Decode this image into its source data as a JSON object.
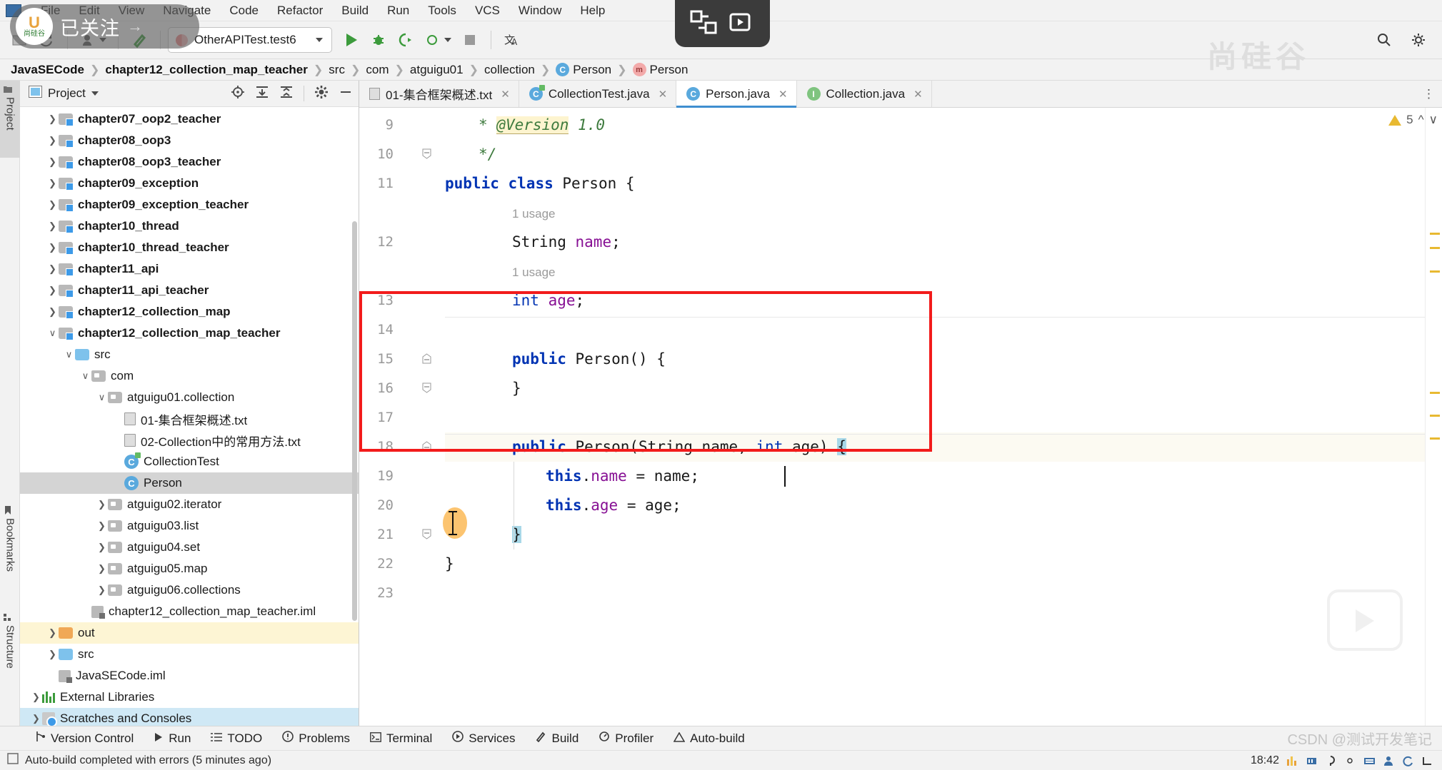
{
  "menubar": {
    "items": [
      "File",
      "Edit",
      "View",
      "Navigate",
      "Code",
      "Refactor",
      "Build",
      "Run",
      "Tools",
      "VCS",
      "Window",
      "Help"
    ],
    "window_icon": "windows-icon"
  },
  "toolbar": {
    "project_icon": "project-folder-icon",
    "sync_icon": "sync-icon",
    "user_icon": "user-icon",
    "hammer_icon": "build-hammer-icon",
    "run_config": "OtherAPITest.test6",
    "run_icon": "run-icon",
    "debug_icon": "debug-icon",
    "coverage_icon": "run-with-coverage-icon",
    "profile_icon": "profile-icon",
    "stop_icon": "stop-icon",
    "translate_icon": "translate-icon",
    "search_icon": "search-icon",
    "settings_icon": "settings-icon"
  },
  "breadcrumb": [
    {
      "label": "JavaSECode",
      "bold": true,
      "icon": null
    },
    {
      "label": "chapter12_collection_map_teacher",
      "bold": true,
      "icon": null
    },
    {
      "label": "src",
      "bold": false,
      "icon": null
    },
    {
      "label": "com",
      "bold": false,
      "icon": null
    },
    {
      "label": "atguigu01",
      "bold": false,
      "icon": null
    },
    {
      "label": "collection",
      "bold": false,
      "icon": null
    },
    {
      "label": "Person",
      "bold": false,
      "icon": "class-icon"
    },
    {
      "label": "Person",
      "bold": false,
      "icon": "method-icon"
    }
  ],
  "rail": {
    "project_label": "Project",
    "bookmarks_label": "Bookmarks",
    "structure_label": "Structure"
  },
  "project_panel": {
    "title": "Project",
    "dropdown_icon": "chevron-down-icon",
    "locate_icon": "locate-icon",
    "expand_icon": "expand-all-icon",
    "collapse_icon": "collapse-all-icon",
    "settings_icon": "gear-icon",
    "hide_icon": "minimize-icon",
    "tree": [
      {
        "label": "chapter07_oop2_teacher",
        "indent": 1,
        "arrow": "right",
        "icon": "module-folder",
        "bold": true,
        "state": ""
      },
      {
        "label": "chapter08_oop3",
        "indent": 1,
        "arrow": "right",
        "icon": "module-folder",
        "bold": true,
        "state": ""
      },
      {
        "label": "chapter08_oop3_teacher",
        "indent": 1,
        "arrow": "right",
        "icon": "module-folder",
        "bold": true,
        "state": ""
      },
      {
        "label": "chapter09_exception",
        "indent": 1,
        "arrow": "right",
        "icon": "module-folder",
        "bold": true,
        "state": ""
      },
      {
        "label": "chapter09_exception_teacher",
        "indent": 1,
        "arrow": "right",
        "icon": "module-folder",
        "bold": true,
        "state": ""
      },
      {
        "label": "chapter10_thread",
        "indent": 1,
        "arrow": "right",
        "icon": "module-folder",
        "bold": true,
        "state": ""
      },
      {
        "label": "chapter10_thread_teacher",
        "indent": 1,
        "arrow": "right",
        "icon": "module-folder",
        "bold": true,
        "state": ""
      },
      {
        "label": "chapter11_api",
        "indent": 1,
        "arrow": "right",
        "icon": "module-folder",
        "bold": true,
        "state": ""
      },
      {
        "label": "chapter11_api_teacher",
        "indent": 1,
        "arrow": "right",
        "icon": "module-folder",
        "bold": true,
        "state": ""
      },
      {
        "label": "chapter12_collection_map",
        "indent": 1,
        "arrow": "right",
        "icon": "module-folder",
        "bold": true,
        "state": ""
      },
      {
        "label": "chapter12_collection_map_teacher",
        "indent": 1,
        "arrow": "down",
        "icon": "module-folder",
        "bold": true,
        "state": ""
      },
      {
        "label": "src",
        "indent": 2,
        "arrow": "down",
        "icon": "source-folder",
        "bold": false,
        "state": ""
      },
      {
        "label": "com",
        "indent": 3,
        "arrow": "down",
        "icon": "package",
        "bold": false,
        "state": ""
      },
      {
        "label": "atguigu01.collection",
        "indent": 4,
        "arrow": "down",
        "icon": "package",
        "bold": false,
        "state": ""
      },
      {
        "label": "01-集合框架概述.txt",
        "indent": 5,
        "arrow": "none",
        "icon": "text-file",
        "bold": false,
        "state": ""
      },
      {
        "label": "02-Collection中的常用方法.txt",
        "indent": 5,
        "arrow": "none",
        "icon": "text-file",
        "bold": false,
        "state": ""
      },
      {
        "label": "CollectionTest",
        "indent": 5,
        "arrow": "none",
        "icon": "runnable-class",
        "bold": false,
        "state": ""
      },
      {
        "label": "Person",
        "indent": 5,
        "arrow": "none",
        "icon": "class",
        "bold": false,
        "state": "sel"
      },
      {
        "label": "atguigu02.iterator",
        "indent": 4,
        "arrow": "right",
        "icon": "package",
        "bold": false,
        "state": ""
      },
      {
        "label": "atguigu03.list",
        "indent": 4,
        "arrow": "right",
        "icon": "package",
        "bold": false,
        "state": ""
      },
      {
        "label": "atguigu04.set",
        "indent": 4,
        "arrow": "right",
        "icon": "package",
        "bold": false,
        "state": ""
      },
      {
        "label": "atguigu05.map",
        "indent": 4,
        "arrow": "right",
        "icon": "package",
        "bold": false,
        "state": ""
      },
      {
        "label": "atguigu06.collections",
        "indent": 4,
        "arrow": "right",
        "icon": "package",
        "bold": false,
        "state": ""
      },
      {
        "label": "chapter12_collection_map_teacher.iml",
        "indent": 3,
        "arrow": "none",
        "icon": "iml-file",
        "bold": false,
        "state": ""
      },
      {
        "label": "out",
        "indent": 1,
        "arrow": "right",
        "icon": "out-folder",
        "bold": false,
        "state": "hl"
      },
      {
        "label": "src",
        "indent": 1,
        "arrow": "right",
        "icon": "source-folder",
        "bold": false,
        "state": ""
      },
      {
        "label": "JavaSECode.iml",
        "indent": 1,
        "arrow": "none",
        "icon": "iml-file",
        "bold": false,
        "state": ""
      },
      {
        "label": "External Libraries",
        "indent": 0,
        "arrow": "right",
        "icon": "libraries",
        "bold": false,
        "state": ""
      },
      {
        "label": "Scratches and Consoles",
        "indent": 0,
        "arrow": "right",
        "icon": "scratches",
        "bold": false,
        "state": "scratch"
      }
    ]
  },
  "editor": {
    "tabs": [
      {
        "label": "01-集合框架概述.txt",
        "icon": "text-file-icon",
        "active": false,
        "close_icon": "close-icon"
      },
      {
        "label": "CollectionTest.java",
        "icon": "runnable-class-icon",
        "active": false,
        "close_icon": "close-icon"
      },
      {
        "label": "Person.java",
        "icon": "class-icon",
        "active": true,
        "close_icon": "close-icon"
      },
      {
        "label": "Collection.java",
        "icon": "interface-icon",
        "active": false,
        "close_icon": "close-icon"
      }
    ],
    "inspection": {
      "warning_count": "5",
      "warning_icon": "warning-triangle-icon",
      "up_icon": "chevron-up-icon",
      "down_icon": "chevron-down-icon"
    },
    "lines": [
      {
        "num": "9",
        "indent": 1,
        "segments": [
          {
            "text": "* ",
            "cls": "doc"
          },
          {
            "text": "@Version",
            "cls": "tag"
          },
          {
            "text": " 1.0",
            "cls": "doc"
          }
        ]
      },
      {
        "num": "10",
        "indent": 1,
        "fold": "end",
        "segments": [
          {
            "text": "*/",
            "cls": "doc"
          }
        ]
      },
      {
        "num": "11",
        "indent": 0,
        "segments": [
          {
            "text": "public ",
            "cls": "kw"
          },
          {
            "text": "class ",
            "cls": "kw"
          },
          {
            "text": "Person {",
            "cls": "typ"
          }
        ]
      },
      {
        "num": "",
        "indent": 2,
        "segments": [
          {
            "text": "1 usage",
            "cls": "usage"
          }
        ]
      },
      {
        "num": "12",
        "indent": 2,
        "segments": [
          {
            "text": "String ",
            "cls": "typ"
          },
          {
            "text": "name",
            "cls": "fld"
          },
          {
            "text": ";",
            "cls": "typ"
          }
        ]
      },
      {
        "num": "",
        "indent": 2,
        "segments": [
          {
            "text": "1 usage",
            "cls": "usage"
          }
        ]
      },
      {
        "num": "13",
        "indent": 2,
        "segments": [
          {
            "text": "int ",
            "cls": "kw2"
          },
          {
            "text": "age",
            "cls": "fld"
          },
          {
            "text": ";",
            "cls": "typ"
          }
        ]
      },
      {
        "num": "14",
        "indent": 0,
        "segments": [
          {
            "text": "",
            "cls": "typ"
          }
        ]
      },
      {
        "num": "15",
        "indent": 2,
        "fold": "start",
        "segments": [
          {
            "text": "public ",
            "cls": "kw"
          },
          {
            "text": "Person() {",
            "cls": "typ"
          }
        ]
      },
      {
        "num": "16",
        "indent": 2,
        "fold": "end",
        "segments": [
          {
            "text": "}",
            "cls": "typ"
          }
        ]
      },
      {
        "num": "17",
        "indent": 0,
        "segments": [
          {
            "text": "",
            "cls": "typ"
          }
        ]
      },
      {
        "num": "18",
        "indent": 2,
        "fold": "start",
        "current": true,
        "segments": [
          {
            "text": "public ",
            "cls": "kw"
          },
          {
            "text": "Person(",
            "cls": "typ"
          },
          {
            "text": "String ",
            "cls": "typ"
          },
          {
            "text": "name, ",
            "cls": "typ"
          },
          {
            "text": "int ",
            "cls": "kw2"
          },
          {
            "text": "age) ",
            "cls": "typ"
          },
          {
            "text": "{",
            "cls": "brace-hl"
          }
        ]
      },
      {
        "num": "19",
        "indent": 3,
        "segments": [
          {
            "text": "this",
            "cls": "kw"
          },
          {
            "text": ".",
            "cls": "typ"
          },
          {
            "text": "name",
            "cls": "fld"
          },
          {
            "text": " = name;",
            "cls": "typ"
          }
        ]
      },
      {
        "num": "20",
        "indent": 3,
        "segments": [
          {
            "text": "this",
            "cls": "kw"
          },
          {
            "text": ".",
            "cls": "typ"
          },
          {
            "text": "age",
            "cls": "fld"
          },
          {
            "text": " = age;",
            "cls": "typ"
          }
        ]
      },
      {
        "num": "21",
        "indent": 2,
        "fold": "end",
        "segments": [
          {
            "text": "}",
            "cls": "brace-hl"
          }
        ]
      },
      {
        "num": "22",
        "indent": 0,
        "segments": [
          {
            "text": "}",
            "cls": "typ"
          }
        ]
      },
      {
        "num": "23",
        "indent": 0,
        "segments": [
          {
            "text": "",
            "cls": "typ"
          }
        ]
      }
    ],
    "annotation_box": {
      "color": "#f21b1b",
      "label": "red-highlight-rectangle"
    },
    "cursor": {
      "icon": "text-ibeam-cursor"
    }
  },
  "toolwindow_bar": [
    {
      "label": "Version Control",
      "icon": "version-control-icon"
    },
    {
      "label": "Run",
      "icon": "run-icon"
    },
    {
      "label": "TODO",
      "icon": "todo-icon"
    },
    {
      "label": "Problems",
      "icon": "problems-icon"
    },
    {
      "label": "Terminal",
      "icon": "terminal-icon"
    },
    {
      "label": "Services",
      "icon": "services-icon"
    },
    {
      "label": "Build",
      "icon": "build-icon"
    },
    {
      "label": "Profiler",
      "icon": "profiler-icon"
    },
    {
      "label": "Auto-build",
      "icon": "auto-build-icon"
    }
  ],
  "statusbar": {
    "message": "Auto-build completed with errors (5 minutes ago)",
    "checkbox_icon": "event-log-icon"
  },
  "system_tray": {
    "time": "18:42",
    "icons": [
      "volume-icon",
      "network-icon",
      "ime-icon",
      "battery-icon",
      "keyboard-icon",
      "user-icon",
      "cloud-icon",
      "tray-icon"
    ]
  },
  "overlays": {
    "follow_badge": {
      "text": "已关注",
      "logo_top": "U",
      "logo_bottom": "尚硅谷",
      "arrow": "→"
    },
    "atguigu_watermark": "尚硅谷",
    "csdn_watermark": "CSDN @测试开发笔记",
    "screen_share_icons": [
      "screen-share-icon",
      "video-record-icon"
    ],
    "player_icon": "video-player-icon"
  },
  "colors": {
    "accent": "#3f8ed0",
    "annotation": "#f21b1b",
    "selection": "#d4d4d4",
    "highlight": "#fdf5d4",
    "keyword": "#0033b3",
    "field": "#871094",
    "doc": "#3d7a3d",
    "warning": "#e8b931"
  }
}
